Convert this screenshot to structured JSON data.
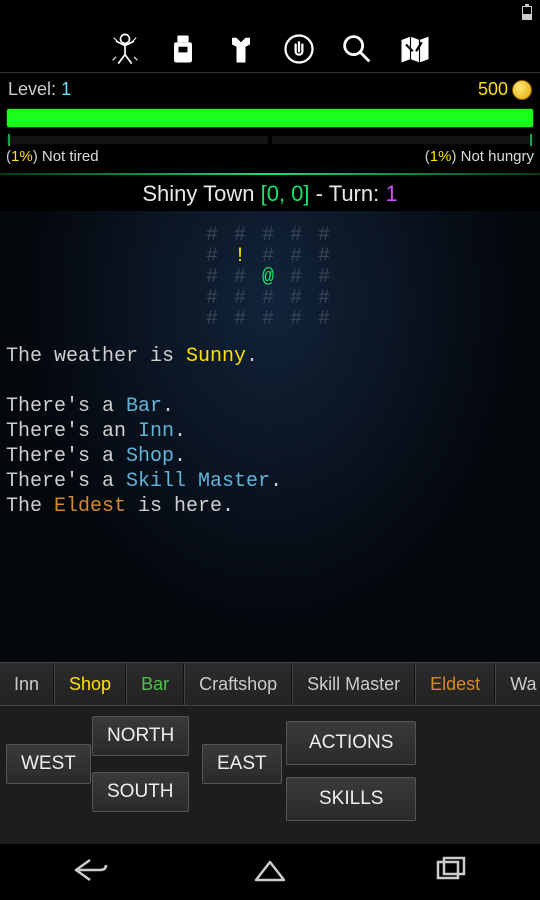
{
  "level": {
    "label": "Level:",
    "value": "1"
  },
  "gold": "500",
  "hp_fill_percent": 100,
  "tired": {
    "pct": "1%",
    "text": "Not tired"
  },
  "hungry": {
    "pct": "1%",
    "text": "Not hungry"
  },
  "location": {
    "name": "Shiny Town",
    "coords": "[0, 0]",
    "turn_label": "Turn:",
    "turn": "1"
  },
  "weather": {
    "prefix": "The weather is ",
    "value": "Sunny",
    "suffix": "."
  },
  "places_desc": [
    {
      "prefix": "There's a ",
      "name": "Bar",
      "class": "c-cyan",
      "suffix": "."
    },
    {
      "prefix": "There's an ",
      "name": "Inn",
      "class": "c-cyan",
      "suffix": "."
    },
    {
      "prefix": "There's a ",
      "name": "Shop",
      "class": "c-cyan",
      "suffix": "."
    },
    {
      "prefix": "There's a ",
      "name": "Skill Master",
      "class": "c-cyan",
      "suffix": "."
    },
    {
      "prefix": "The ",
      "name": "Eldest",
      "class": "c-orange",
      "suffix": " is here."
    }
  ],
  "place_tabs": [
    {
      "label": "Inn",
      "cls": ""
    },
    {
      "label": "Shop",
      "cls": "yellow"
    },
    {
      "label": "Bar",
      "cls": "green"
    },
    {
      "label": "Craftshop",
      "cls": ""
    },
    {
      "label": "Skill Master",
      "cls": ""
    },
    {
      "label": "Eldest",
      "cls": "orange"
    },
    {
      "label": "Wa",
      "cls": ""
    }
  ],
  "compass": {
    "north": "NORTH",
    "south": "SOUTH",
    "east": "EAST",
    "west": "WEST"
  },
  "right_buttons": {
    "actions": "ACTIONS",
    "skills": "SKILLS"
  },
  "top_icons": [
    "body-icon",
    "bag-icon",
    "armor-icon",
    "hand-icon",
    "search-icon",
    "map-icon"
  ]
}
